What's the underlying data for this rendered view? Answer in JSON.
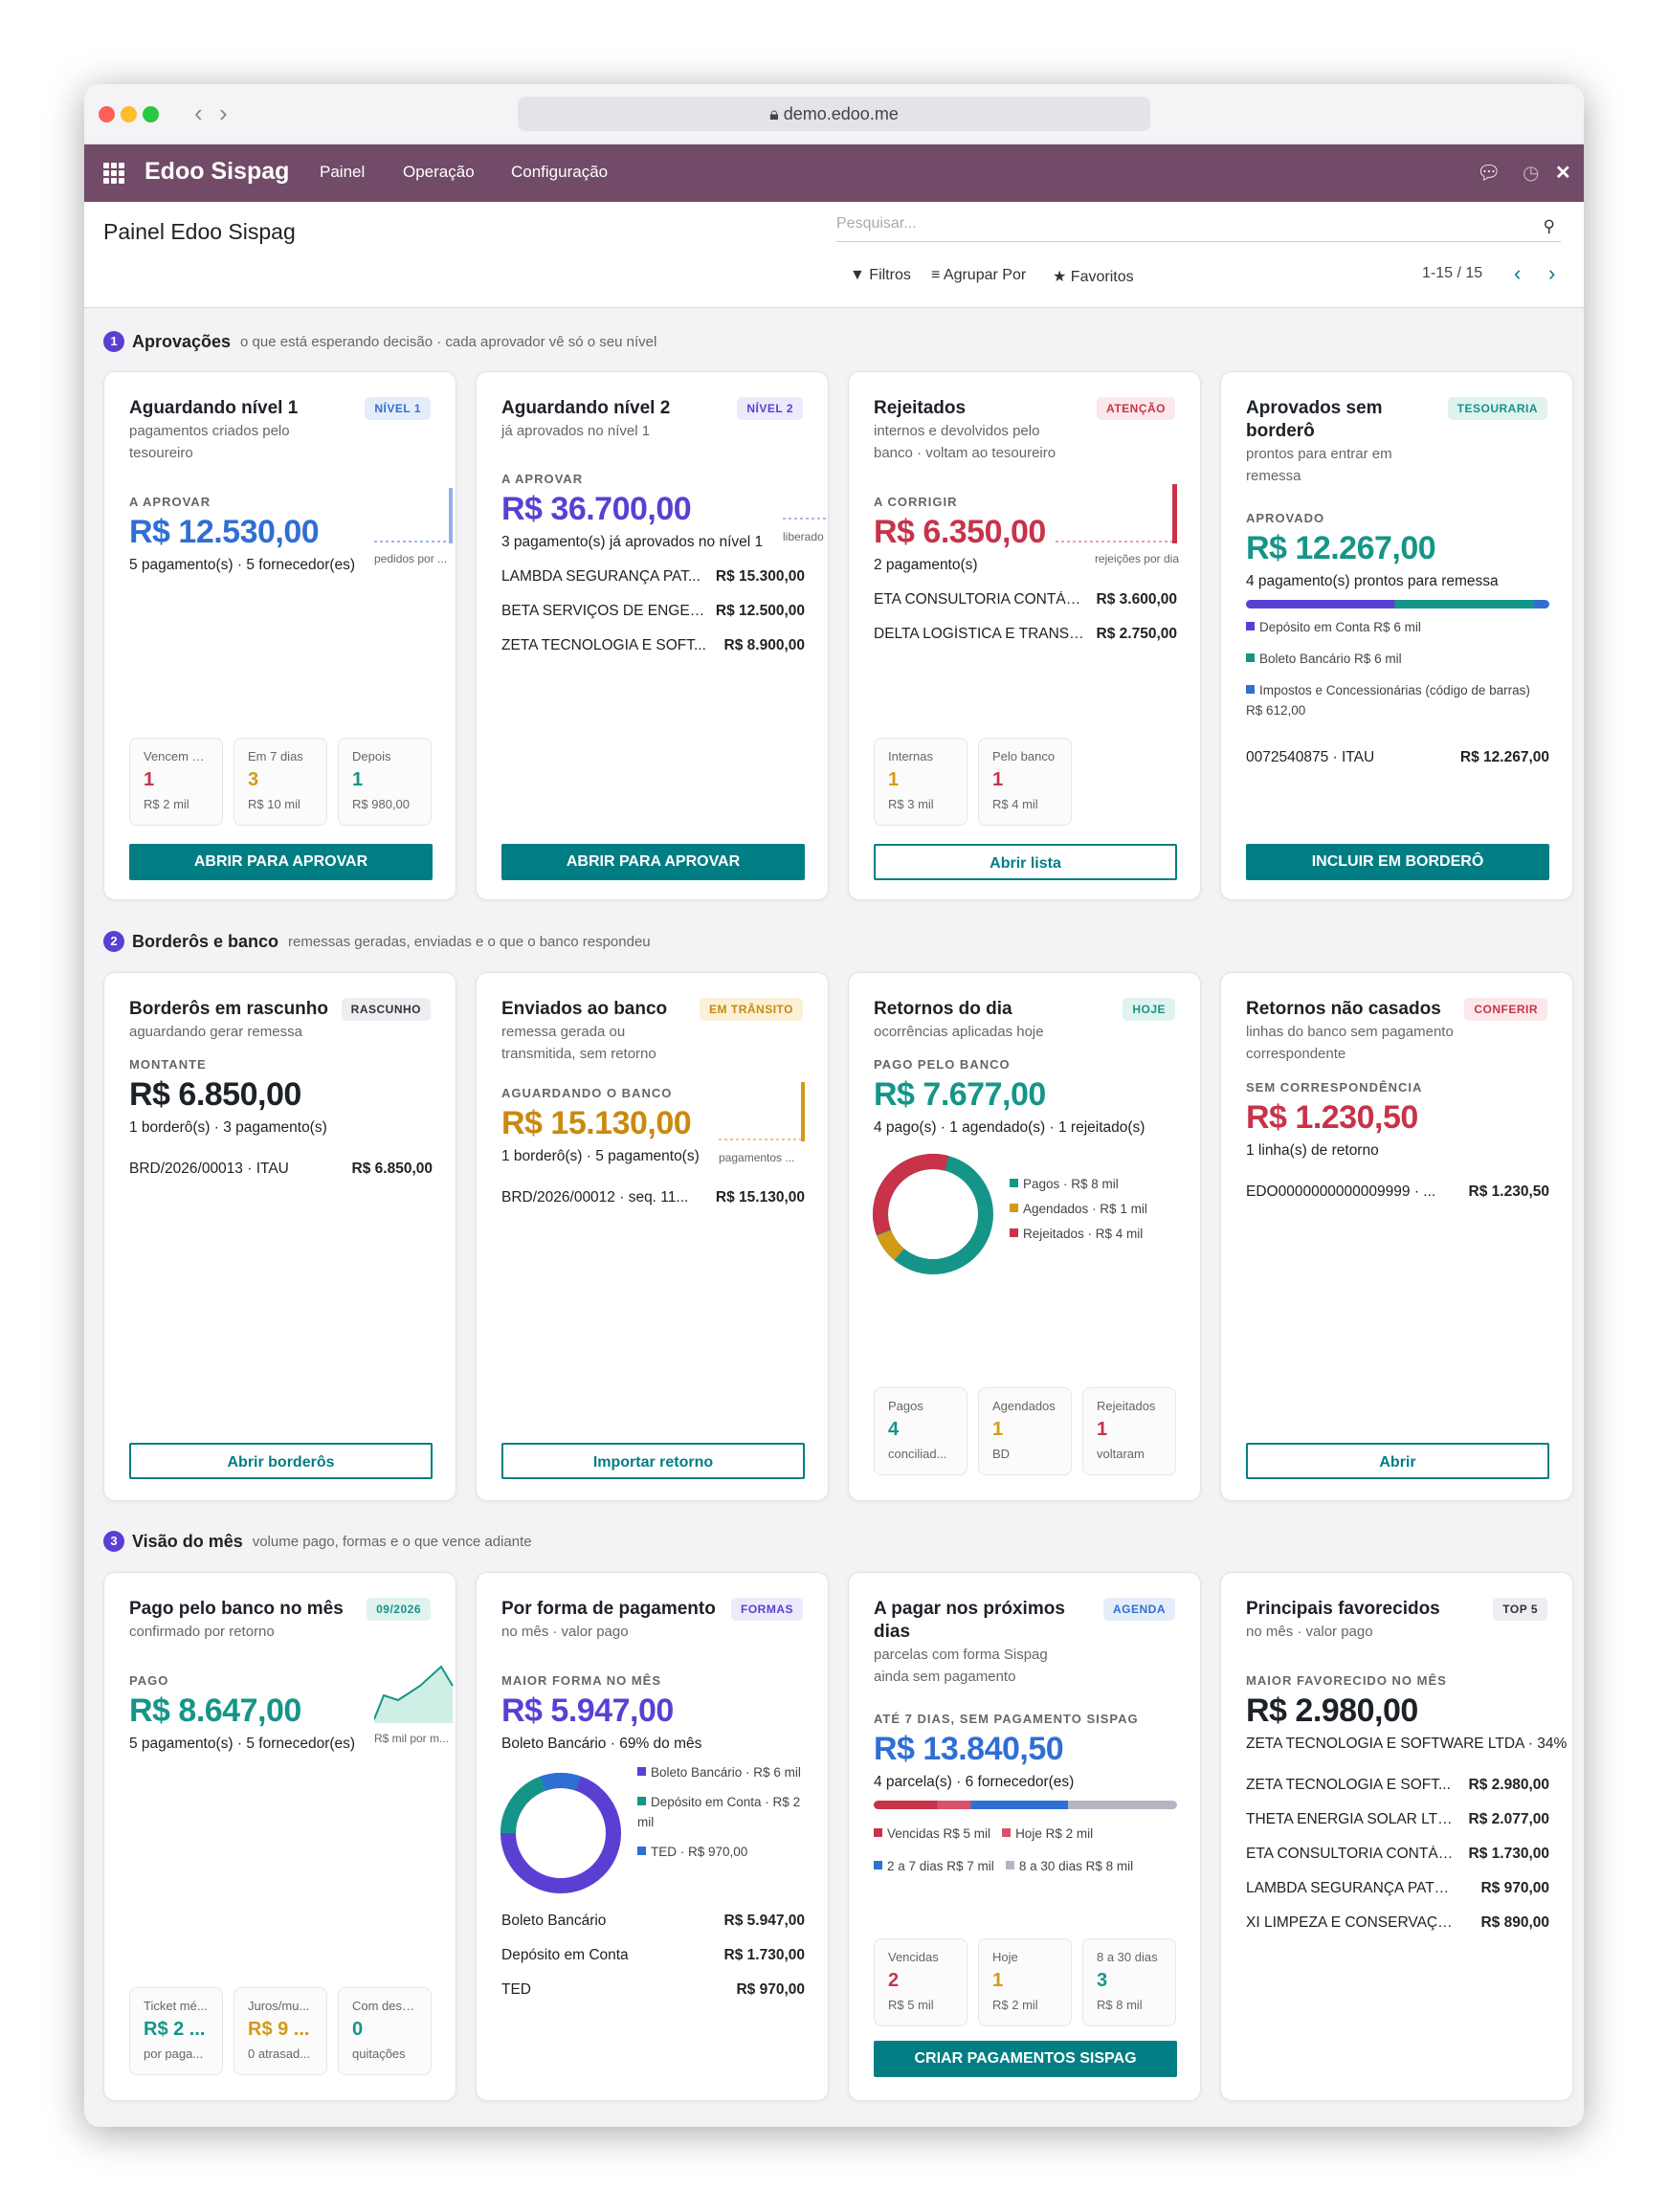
{
  "browser": {
    "url": "demo.edoo.me"
  },
  "app": {
    "name": "Edoo Sispag",
    "menu": [
      "Painel",
      "Operação",
      "Configuração"
    ]
  },
  "control": {
    "title": "Painel Edoo Sispag",
    "search_placeholder": "Pesquisar...",
    "filters": "Filtros",
    "group_by": "Agrupar Por",
    "favorites": "Favoritos",
    "pager": "1-15 / 15"
  },
  "colors": {
    "brand": "#714b67",
    "teal": "#017e84",
    "purple": "#5b3fd3",
    "blue": "#2f6fd3",
    "green": "#159588",
    "orange": "#d39a17",
    "red": "#c8334a"
  },
  "s1": {
    "num": "1",
    "title": "Aprovações",
    "sub": "o que está esperando decisão · cada aprovador vê só o seu nível",
    "c1": {
      "title": "Aguardando nível 1",
      "desc": "pagamentos criados pelo tesoureiro",
      "badge": "NÍVEL 1",
      "label": "A APROVAR",
      "value": "R$ 12.530,00",
      "sub": "5 pagamento(s) · 5 fornecedor(es)",
      "spark": "pedidos por ...",
      "stats": [
        {
          "l": "Vencem h...",
          "v": "1",
          "s": "R$ 2 mil"
        },
        {
          "l": "Em 7 dias",
          "v": "3",
          "s": "R$ 10 mil"
        },
        {
          "l": "Depois",
          "v": "1",
          "s": "R$ 980,00"
        }
      ],
      "btn": "ABRIR PARA APROVAR"
    },
    "c2": {
      "title": "Aguardando nível 2",
      "desc": "já aprovados no nível 1",
      "badge": "NÍVEL 2",
      "label": "A APROVAR",
      "value": "R$ 36.700,00",
      "sub": "3 pagamento(s) já aprovados no nível 1",
      "spark": "liberado",
      "rows": [
        {
          "n": "LAMBDA SEGURANÇA PAT...",
          "v": "R$ 15.300,00"
        },
        {
          "n": "BETA SERVIÇOS DE ENGEN...",
          "v": "R$ 12.500,00"
        },
        {
          "n": "ZETA TECNOLOGIA E SOFT...",
          "v": "R$ 8.900,00"
        }
      ],
      "btn": "ABRIR PARA APROVAR"
    },
    "c3": {
      "title": "Rejeitados",
      "desc": "internos e devolvidos pelo banco · voltam ao tesoureiro",
      "badge": "ATENÇÃO",
      "label": "A CORRIGIR",
      "value": "R$ 6.350,00",
      "sub": "2 pagamento(s)",
      "spark": "rejeições por dia",
      "rows": [
        {
          "n": "ETA CONSULTORIA CONTÁB...",
          "v": "R$ 3.600,00"
        },
        {
          "n": "DELTA LOGÍSTICA E TRANSP...",
          "v": "R$ 2.750,00"
        }
      ],
      "stats": [
        {
          "l": "Internas",
          "v": "1",
          "s": "R$ 3 mil"
        },
        {
          "l": "Pelo banco",
          "v": "1",
          "s": "R$ 4 mil"
        }
      ],
      "btn": "Abrir lista"
    },
    "c4": {
      "title": "Aprovados sem borderô",
      "desc": "prontos para entrar em remessa",
      "badge": "TESOURARIA",
      "label": "APROVADO",
      "value": "R$ 12.267,00",
      "sub": "4 pagamento(s) prontos para remessa",
      "legend": [
        "Depósito em Conta R$ 6 mil",
        "Boleto Bancário R$ 6 mil",
        "Impostos e Concessionárias (código de barras) R$ 612,00"
      ],
      "rows": [
        {
          "n": "0072540875 · ITAU",
          "v": "R$ 12.267,00"
        }
      ],
      "btn": "INCLUIR EM BORDERÔ"
    }
  },
  "s2": {
    "num": "2",
    "title": "Borderôs e banco",
    "sub": "remessas geradas, enviadas e o que o banco respondeu",
    "c1": {
      "title": "Borderôs em rascunho",
      "desc": "aguardando gerar remessa",
      "badge": "RASCUNHO",
      "label": "MONTANTE",
      "value": "R$ 6.850,00",
      "sub": "1 borderô(s) · 3 pagamento(s)",
      "rows": [
        {
          "n": "BRD/2026/00013 · ITAU",
          "v": "R$ 6.850,00"
        }
      ],
      "btn": "Abrir borderôs"
    },
    "c2": {
      "title": "Enviados ao banco",
      "desc": "remessa gerada ou transmitida, sem retorno",
      "badge": "EM TRÂNSITO",
      "label": "AGUARDANDO O BANCO",
      "value": "R$ 15.130,00",
      "sub": "1 borderô(s) · 5 pagamento(s)",
      "spark": "pagamentos ...",
      "rows": [
        {
          "n": "BRD/2026/00012 · seq. 11...",
          "v": "R$ 15.130,00"
        }
      ],
      "btn": "Importar retorno"
    },
    "c3": {
      "title": "Retornos do dia",
      "desc": "ocorrências aplicadas hoje",
      "badge": "HOJE",
      "label": "PAGO PELO BANCO",
      "value": "R$ 7.677,00",
      "sub": "4 pago(s) · 1 agendado(s) · 1 rejeitado(s)",
      "legend": [
        "Pagos · R$ 8 mil",
        "Agendados · R$ 1 mil",
        "Rejeitados · R$ 4 mil"
      ],
      "stats": [
        {
          "l": "Pagos",
          "v": "4",
          "s": "conciliad..."
        },
        {
          "l": "Agendados",
          "v": "1",
          "s": "BD"
        },
        {
          "l": "Rejeitados",
          "v": "1",
          "s": "voltaram"
        }
      ]
    },
    "c4": {
      "title": "Retornos não casados",
      "desc": "linhas do banco sem pagamento correspondente",
      "badge": "CONFERIR",
      "label": "SEM CORRESPONDÊNCIA",
      "value": "R$ 1.230,50",
      "sub": "1 linha(s) de retorno",
      "rows": [
        {
          "n": "EDO0000000000009999 · ...",
          "v": "R$ 1.230,50"
        }
      ],
      "btn": "Abrir"
    }
  },
  "s3": {
    "num": "3",
    "title": "Visão do mês",
    "sub": "volume pago, formas e o que vence adiante",
    "c1": {
      "title": "Pago pelo banco no mês",
      "desc": "confirmado por retorno",
      "badge": "09/2026",
      "label": "PAGO",
      "value": "R$ 8.647,00",
      "sub": "5 pagamento(s) · 5 fornecedor(es)",
      "spark": "R$ mil por m...",
      "stats": [
        {
          "l": "Ticket mé...",
          "v": "R$ 2 ...",
          "s": "por paga..."
        },
        {
          "l": "Juros/mu...",
          "v": "R$ 9 ...",
          "s": "0 atrasad..."
        },
        {
          "l": "Com desc...",
          "v": "0",
          "s": "quitações"
        }
      ]
    },
    "c2": {
      "title": "Por forma de pagamento",
      "desc": "no mês · valor pago",
      "badge": "FORMAS",
      "label": "MAIOR FORMA NO MÊS",
      "value": "R$ 5.947,00",
      "sub": "Boleto Bancário · 69% do mês",
      "legend": [
        "Boleto Bancário · R$ 6 mil",
        "Depósito em Conta · R$ 2 mil",
        "TED · R$ 970,00"
      ],
      "rows": [
        {
          "n": "Boleto Bancário",
          "v": "R$ 5.947,00"
        },
        {
          "n": "Depósito em Conta",
          "v": "R$ 1.730,00"
        },
        {
          "n": "TED",
          "v": "R$ 970,00"
        }
      ]
    },
    "c3": {
      "title": "A pagar nos próximos dias",
      "desc": "parcelas com forma Sispag ainda sem pagamento",
      "badge": "AGENDA",
      "label": "ATÉ 7 DIAS, SEM PAGAMENTO SISPAG",
      "value": "R$ 13.840,50",
      "sub": "4 parcela(s) · 6 fornecedor(es)",
      "legend": [
        "Vencidas R$ 5 mil",
        "Hoje R$ 2 mil",
        "2 a 7 dias R$ 7 mil",
        "8 a 30 dias R$ 8 mil"
      ],
      "stats": [
        {
          "l": "Vencidas",
          "v": "2",
          "s": "R$ 5 mil"
        },
        {
          "l": "Hoje",
          "v": "1",
          "s": "R$ 2 mil"
        },
        {
          "l": "8 a 30 dias",
          "v": "3",
          "s": "R$ 8 mil"
        }
      ],
      "btn": "CRIAR PAGAMENTOS SISPAG"
    },
    "c4": {
      "title": "Principais favorecidos",
      "desc": "no mês · valor pago",
      "badge": "TOP 5",
      "label": "MAIOR FAVORECIDO NO MÊS",
      "value": "R$ 2.980,00",
      "sub": "ZETA TECNOLOGIA E SOFTWARE LTDA · 34%",
      "rows": [
        {
          "n": "ZETA TECNOLOGIA E SOFT...",
          "v": "R$ 2.980,00"
        },
        {
          "n": "THETA ENERGIA SOLAR LTDA",
          "v": "R$ 2.077,00"
        },
        {
          "n": "ETA CONSULTORIA CONTÁB...",
          "v": "R$ 1.730,00"
        },
        {
          "n": "LAMBDA SEGURANÇA PATRI...",
          "v": "R$ 970,00"
        },
        {
          "n": "XI LIMPEZA E CONSERVAÇÃO ...",
          "v": "R$ 890,00"
        }
      ]
    }
  }
}
